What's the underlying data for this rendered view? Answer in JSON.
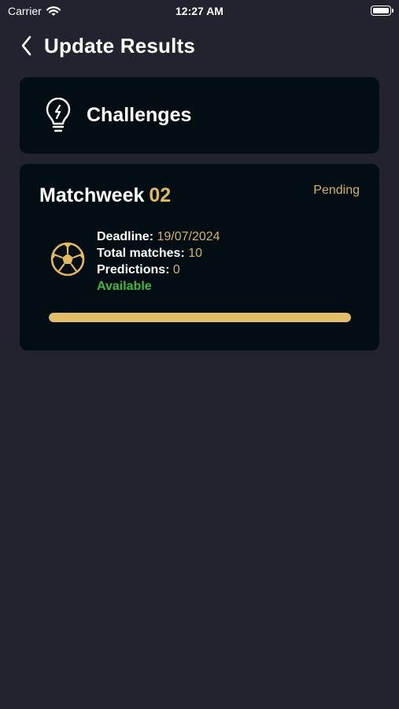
{
  "status_bar": {
    "carrier": "Carrier",
    "time": "12:27 AM"
  },
  "header": {
    "title": "Update Results"
  },
  "challenges": {
    "label": "Challenges"
  },
  "matchweek": {
    "title_prefix": "Matchweek",
    "number": "02",
    "status": "Pending",
    "deadline_label": "Deadline:",
    "deadline_value": "19/07/2024",
    "total_matches_label": "Total matches:",
    "total_matches_value": "10",
    "predictions_label": "Predictions:",
    "predictions_value": "0",
    "availability": "Available",
    "progress_fraction": 1.0
  },
  "colors": {
    "background": "#22232f",
    "card": "#030d14",
    "accent_gold": "#e2b860",
    "available_green": "#3fb83c"
  },
  "icons": {
    "back": "chevron-left-icon",
    "challenges": "lightbulb-icon",
    "matchweek": "soccer-ball-icon",
    "wifi": "wifi-icon",
    "battery": "battery-icon"
  }
}
